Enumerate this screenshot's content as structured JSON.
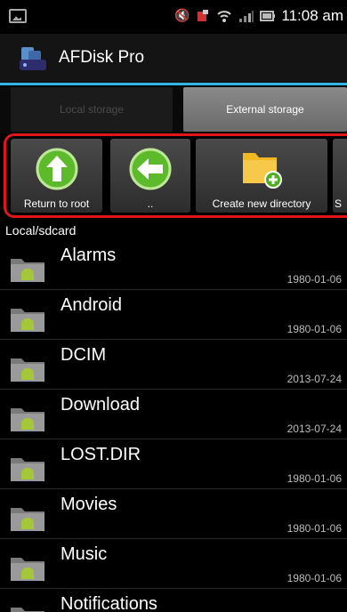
{
  "status_bar": {
    "time": "11:08 am",
    "icons": [
      "gallery-icon",
      "mute-icon",
      "notification-icon",
      "wifi-icon",
      "signal-icon",
      "battery-icon"
    ]
  },
  "app": {
    "title": "AFDisk Pro"
  },
  "tabs": [
    {
      "label": "Local storage",
      "active": false
    },
    {
      "label": "External storage",
      "active": true
    }
  ],
  "toolbar": {
    "items": [
      {
        "label": "Return to root",
        "icon": "arrow-up-icon"
      },
      {
        "label": "..",
        "icon": "arrow-left-icon"
      },
      {
        "label": "Create new directory",
        "icon": "new-folder-icon"
      },
      {
        "label": "S",
        "icon": "partial-icon"
      }
    ]
  },
  "path": "Local/sdcard",
  "files": [
    {
      "name": "Alarms",
      "date": "1980-01-06"
    },
    {
      "name": "Android",
      "date": "1980-01-06"
    },
    {
      "name": "DCIM",
      "date": "2013-07-24"
    },
    {
      "name": "Download",
      "date": "2013-07-24"
    },
    {
      "name": "LOST.DIR",
      "date": "1980-01-06"
    },
    {
      "name": "Movies",
      "date": "1980-01-06"
    },
    {
      "name": "Music",
      "date": "1980-01-06"
    },
    {
      "name": "Notifications",
      "date": ""
    }
  ],
  "colors": {
    "accent": "#33b5e5",
    "highlight_border": "#e0161b",
    "green_button": "#5dbb2b"
  }
}
